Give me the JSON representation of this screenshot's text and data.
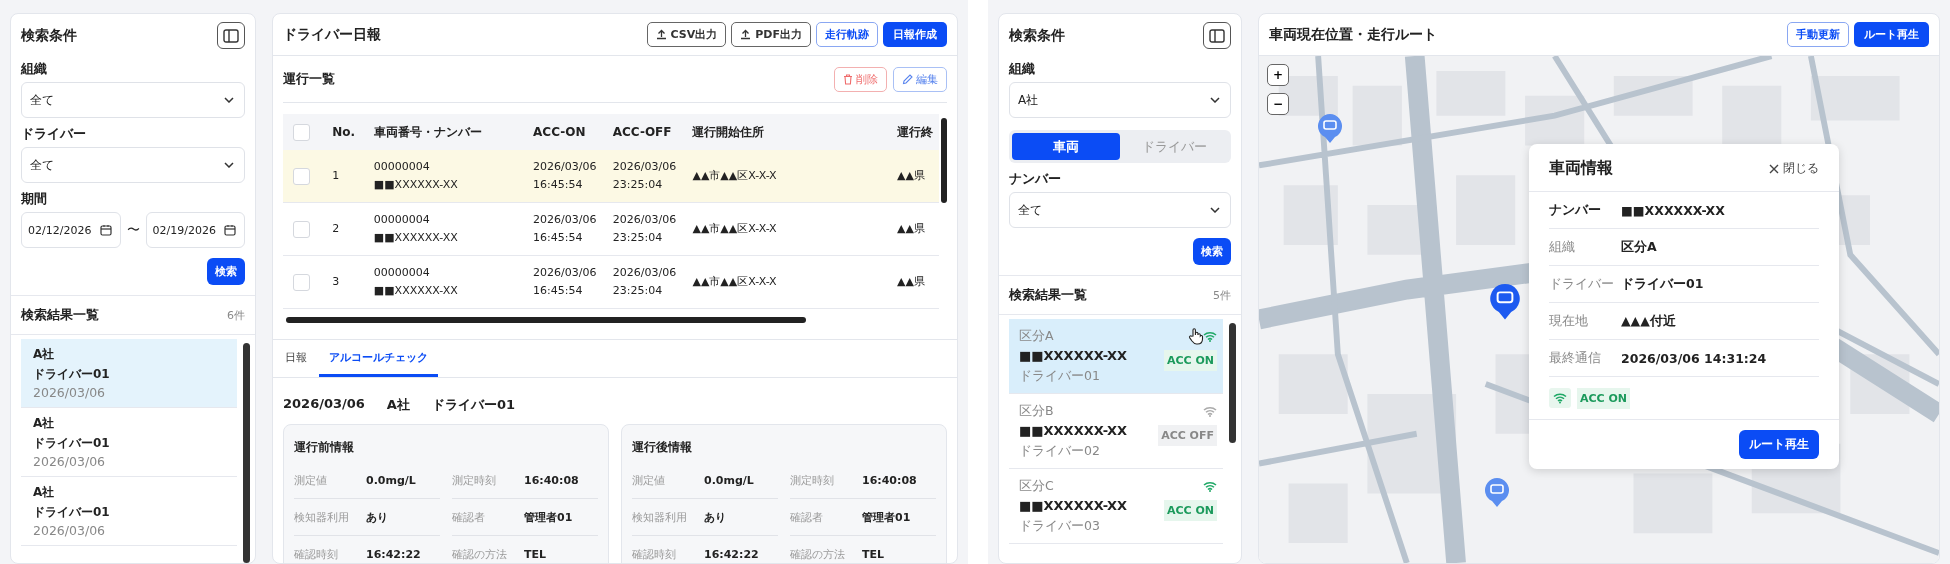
{
  "left_app": {
    "sidebar": {
      "title": "検索条件",
      "fields": [
        {
          "label": "組織",
          "value": "全て"
        },
        {
          "label": "ドライバー",
          "value": "全て"
        }
      ],
      "period": {
        "label": "期間",
        "from": "02/12/2026",
        "separator": "〜",
        "to": "02/19/2026"
      },
      "search_button": "検索",
      "results": {
        "title": "検索結果一覧",
        "count": "6件",
        "items": [
          {
            "company": "A社",
            "driver": "ドライバー01",
            "date": "2026/03/06",
            "selected": true
          },
          {
            "company": "A社",
            "driver": "ドライバー01",
            "date": "2026/03/06",
            "selected": false
          },
          {
            "company": "A社",
            "driver": "ドライバー01",
            "date": "2026/03/06",
            "selected": false
          }
        ]
      }
    },
    "main": {
      "title": "ドライバー日報",
      "buttons": [
        {
          "label": "CSV出力",
          "kind": "export"
        },
        {
          "label": "PDF出力",
          "kind": "export"
        },
        {
          "label": "走行軌跡",
          "kind": "outline"
        },
        {
          "label": "日報作成",
          "kind": "primary"
        }
      ],
      "trips": {
        "title": "運行一覧",
        "actions": [
          {
            "label": "削除",
            "kind": "delete"
          },
          {
            "label": "編集",
            "kind": "edit"
          }
        ],
        "header_checked": false,
        "columns": [
          "No.",
          "車両番号・ナンバー",
          "ACC-ON",
          "ACC-OFF",
          "運行開始住所",
          "運行終"
        ],
        "rows": [
          {
            "checked": false,
            "selected": true,
            "no": "1",
            "vehicle": "00000004",
            "plate": "■■XXXXXX-XX",
            "on_date": "2026/03/06",
            "on_time": "16:45:54",
            "off_date": "2026/03/06",
            "off_time": "23:25:04",
            "start": "▲▲市▲▲区X-X-X",
            "end": "▲▲県"
          },
          {
            "checked": false,
            "selected": false,
            "no": "2",
            "vehicle": "00000004",
            "plate": "■■XXXXXX-XX",
            "on_date": "2026/03/06",
            "on_time": "16:45:54",
            "off_date": "2026/03/06",
            "off_time": "23:25:04",
            "start": "▲▲市▲▲区X-X-X",
            "end": "▲▲県"
          },
          {
            "checked": false,
            "selected": false,
            "no": "3",
            "vehicle": "00000004",
            "plate": "■■XXXXXX-XX",
            "on_date": "2026/03/06",
            "on_time": "16:45:54",
            "off_date": "2026/03/06",
            "off_time": "23:25:04",
            "start": "▲▲市▲▲区X-X-X",
            "end": "▲▲県"
          }
        ]
      },
      "tabs": [
        {
          "label": "日報",
          "selected": false
        },
        {
          "label": "アルコールチェック",
          "selected": true
        }
      ],
      "summary": {
        "date": "2026/03/06",
        "company": "A社",
        "driver": "ドライバー01"
      },
      "cards": [
        {
          "title": "運行前情報",
          "fields": [
            {
              "label": "測定値",
              "value": "0.0mg/L"
            },
            {
              "label": "測定時刻",
              "value": "16:40:08"
            },
            {
              "label": "検知器利用",
              "value": "あり"
            },
            {
              "label": "確認者",
              "value": "管理者01"
            },
            {
              "label": "確認時刻",
              "value": "16:42:22"
            },
            {
              "label": "確認の方法",
              "value": "TEL"
            }
          ]
        },
        {
          "title": "運行後情報",
          "fields": [
            {
              "label": "測定値",
              "value": "0.0mg/L"
            },
            {
              "label": "測定時刻",
              "value": "16:40:08"
            },
            {
              "label": "検知器利用",
              "value": "あり"
            },
            {
              "label": "確認者",
              "value": "管理者01"
            },
            {
              "label": "確認時刻",
              "value": "16:42:22"
            },
            {
              "label": "確認の方法",
              "value": "TEL"
            }
          ]
        }
      ]
    }
  },
  "right_app": {
    "sidebar": {
      "title": "検索条件",
      "org": {
        "label": "組織",
        "value": "A社"
      },
      "segments": [
        {
          "label": "車両",
          "selected": true
        },
        {
          "label": "ドライバー",
          "selected": false
        }
      ],
      "number": {
        "label": "ナンバー",
        "value": "全て"
      },
      "search_button": "検索",
      "results": {
        "title": "検索結果一覧",
        "count": "5件",
        "items": [
          {
            "category": "区分A",
            "plate": "■■XXXXXX-XX",
            "driver": "ドライバー01",
            "acc": "ACC ON",
            "acc_on": true,
            "selected": true
          },
          {
            "category": "区分B",
            "plate": "■■XXXXXX-XX",
            "driver": "ドライバー02",
            "acc": "ACC OFF",
            "acc_on": false,
            "selected": false
          },
          {
            "category": "区分C",
            "plate": "■■XXXXXX-XX",
            "driver": "ドライバー03",
            "acc": "ACC ON",
            "acc_on": true,
            "selected": false
          }
        ]
      }
    },
    "map": {
      "title": "車両現在位置・走行ルート",
      "buttons": [
        {
          "label": "手動更新",
          "kind": "outline"
        },
        {
          "label": "ルート再生",
          "kind": "primary"
        }
      ],
      "zoom_in": "+",
      "zoom_out": "−",
      "popup": {
        "title": "車両情報",
        "close": "閉じる",
        "rows": [
          {
            "label": "ナンバー",
            "value": "■■XXXXXX-XX"
          },
          {
            "label": "組織",
            "value": "区分A"
          },
          {
            "label": "ドライバー",
            "value": "ドライバー01"
          },
          {
            "label": "現在地",
            "value": "▲▲▲付近"
          },
          {
            "label": "最終通信",
            "value": "2026/03/06 14:31:24"
          }
        ],
        "acc": "ACC ON",
        "acc_on": true,
        "button": "ルート再生"
      }
    }
  }
}
